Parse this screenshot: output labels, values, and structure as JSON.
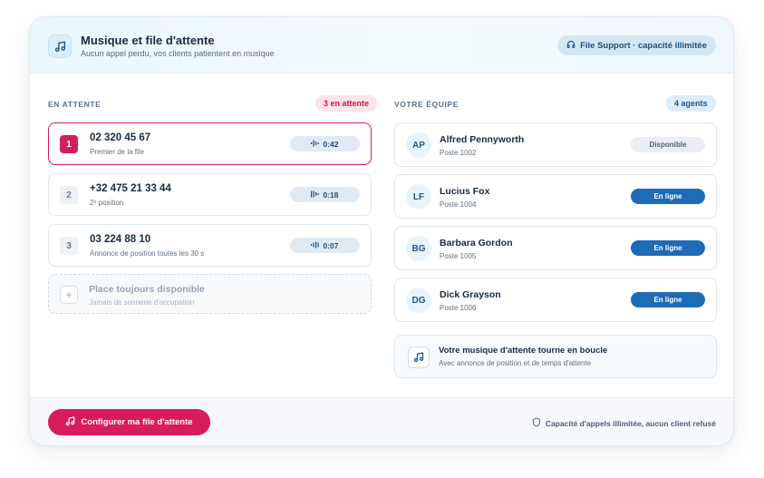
{
  "header": {
    "title": "Musique et file d'attente",
    "subtitle": "Aucun appel perdu, vos clients patientent en musique",
    "badge": "File Support · capacité illimitée",
    "icon": "music-note-icon"
  },
  "queue": {
    "label": "EN ATTENTE",
    "count": "3 en attente",
    "items": [
      {
        "rank": "1",
        "phone": "02 320 45 67",
        "status": "Premier de la file",
        "timer": "0:42",
        "active": true
      },
      {
        "rank": "2",
        "phone": "+32 475 21 33 44",
        "status": "2ᵉ position",
        "timer": "0:18",
        "active": false
      },
      {
        "rank": "3",
        "phone": "03 224 88 10",
        "status": "Annonce de position toutes les 30 s",
        "timer": "0:07",
        "active": false
      }
    ],
    "placeholder": {
      "title": "Place toujours disponible",
      "subtitle": "Jamais de sonnerie d'occupation"
    }
  },
  "team": {
    "label": "VOTRE ÉQUIPE",
    "count": "4 agents",
    "agents": [
      {
        "initials": "AP",
        "name": "Alfred Pennyworth",
        "extension": "Poste 1002",
        "status": "Disponible",
        "online": false
      },
      {
        "initials": "LF",
        "name": "Lucius Fox",
        "extension": "Poste 1004",
        "status": "En ligne",
        "online": true
      },
      {
        "initials": "BG",
        "name": "Barbara Gordon",
        "extension": "Poste 1005",
        "status": "En ligne",
        "online": true
      },
      {
        "initials": "DG",
        "name": "Dick Grayson",
        "extension": "Poste 1006",
        "status": "En ligne",
        "online": true
      }
    ],
    "music": {
      "title": "Votre musique d'attente tourne en boucle",
      "subtitle": "Avec annonce de position et de temps d'attente"
    }
  },
  "footer": {
    "cta": "Configurer ma file d'attente",
    "note": "Capacité d'appels illimitée, aucun client refusé"
  },
  "colors": {
    "accent": "#d81b5a",
    "online": "#1e6bb8",
    "brand_blue": "#1d4f7a"
  }
}
